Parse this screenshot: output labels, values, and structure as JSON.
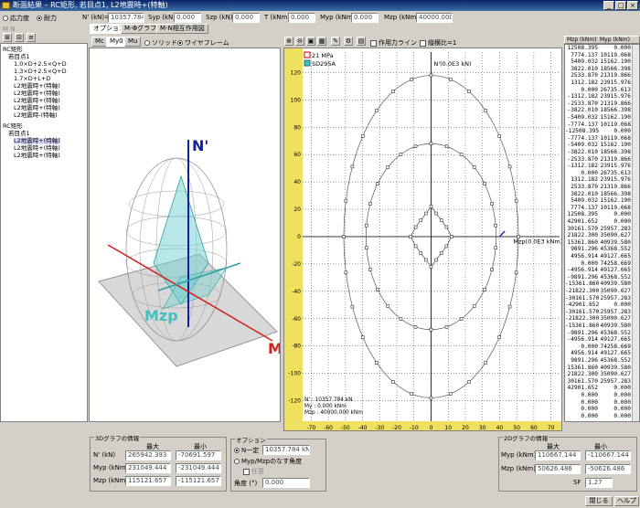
{
  "window": {
    "title": "断面結果 – RC矩形, 若目点1, L2地震時+(特軸)"
  },
  "toolbar_top": {
    "stress_label": "応力度",
    "yield_label": "耐力",
    "n_label": "N' (kN)=",
    "n_value": "10357.784",
    "syp_label": "Syp (kN)=",
    "syp_value": "0.000",
    "szp_label": "Szp (kN)=",
    "szp_value": "0.000",
    "t_label": "T (kNm)=",
    "t_value": "0.000",
    "myp_label": "Myp (kNm)=",
    "myp_value": "0.000",
    "mzp_label": "Mzp (kNm)=",
    "mzp_value": "40000.000",
    "sub_label": "M  N"
  },
  "tabs": [
    "オプション",
    "M-Φグラフ",
    "M-N相互作用図"
  ],
  "view_tabs": [
    "Mc",
    "My0",
    "Mu"
  ],
  "view_mode": {
    "solid": "ソリッド",
    "wire": "ワイヤフレーム"
  },
  "graph_toolbar": {
    "action_line": "作用力ライン",
    "ratio": "縦横比=1"
  },
  "tree": [
    "RC矩形",
    "若目点1",
    "1.0×D+2.5×Q+D",
    "1.3×D+2.5×Q+D",
    "1.7×D+L+D",
    "L2地震時+(特軸)",
    "L2地震時+(特軸)",
    "L2地震時+(特軸)",
    "L2地震時+(特軸)",
    "L2地震時-(特軸)",
    "RC矩形",
    "若目点1",
    "L2地震時+(特軸)",
    "L2地震時+(特軸)",
    "L2地震時+(特軸)"
  ],
  "axes3d": {
    "n": "N'",
    "mzp": "Mzp",
    "m": "M"
  },
  "plot": {
    "legend": [
      "21 MPa",
      "SD295A"
    ],
    "y_axis_label": "N'(0.0E3 kN)",
    "x_axis_label": "Mzp(0.0E3 kNm)",
    "x_ticks": [
      "-70",
      "-60",
      "-50",
      "-40",
      "-30",
      "-20",
      "-10",
      "0",
      "10",
      "20",
      "30",
      "40",
      "50",
      "60",
      "70"
    ],
    "y_ticks": [
      "120",
      "100",
      "80",
      "60",
      "40",
      "20",
      "0",
      "-20",
      "-40",
      "-60",
      "-80",
      "-100",
      "-120"
    ],
    "info_lines": [
      "N' : 10357.784 kN",
      "My : 0.000 kNm",
      "Mzp : 40000.000 kNm"
    ]
  },
  "list": {
    "headers": [
      "Mzp (kNm)",
      "Myp (kNm)"
    ],
    "rows": [
      [
        "12508.395",
        "0.000"
      ],
      [
        "7774.137",
        "10119.068"
      ],
      [
        "5409.032",
        "15162.190"
      ],
      [
        "3822.010",
        "18566.398"
      ],
      [
        "2533.870",
        "21319.866"
      ],
      [
        "1312.182",
        "23915.976"
      ],
      [
        "0.000",
        "26735.613"
      ],
      [
        "-1312.182",
        "23915.976"
      ],
      [
        "-2533.870",
        "21319.866"
      ],
      [
        "-3822.010",
        "18566.398"
      ],
      [
        "-5409.032",
        "15162.190"
      ],
      [
        "-7774.137",
        "10119.068"
      ],
      [
        "-12508.395",
        "0.000"
      ],
      [
        "-7774.137",
        "10119.068"
      ],
      [
        "-5409.032",
        "15162.190"
      ],
      [
        "-3822.010",
        "18566.398"
      ],
      [
        "-2533.870",
        "21319.866"
      ],
      [
        "-1312.182",
        "23915.976"
      ],
      [
        "0.000",
        "26735.613"
      ],
      [
        "1312.182",
        "23915.976"
      ],
      [
        "2533.870",
        "21319.866"
      ],
      [
        "3822.010",
        "18566.398"
      ],
      [
        "5409.032",
        "15162.190"
      ],
      [
        "7774.137",
        "10119.068"
      ],
      [
        "12508.395",
        "0.000"
      ],
      [
        "42901.652",
        "0.000"
      ],
      [
        "30161.570",
        "25957.283"
      ],
      [
        "21822.300",
        "35090.627"
      ],
      [
        "15361.860",
        "40939.580"
      ],
      [
        "9891.296",
        "45368.552"
      ],
      [
        "4956.914",
        "49127.665"
      ],
      [
        "0.000",
        "74258.669"
      ],
      [
        "-4956.914",
        "49127.665"
      ],
      [
        "-9891.296",
        "45368.552"
      ],
      [
        "-15361.860",
        "40939.580"
      ],
      [
        "-21822.300",
        "35090.627"
      ],
      [
        "-30161.570",
        "25957.283"
      ],
      [
        "-42901.652",
        "0.000"
      ],
      [
        "-30161.570",
        "25957.283"
      ],
      [
        "-21822.300",
        "35090.627"
      ],
      [
        "-15361.860",
        "40939.580"
      ],
      [
        "-9891.296",
        "45368.552"
      ],
      [
        "-4956.914",
        "49127.665"
      ],
      [
        "0.000",
        "74258.669"
      ],
      [
        "4956.914",
        "49127.665"
      ],
      [
        "9891.296",
        "45368.552"
      ],
      [
        "15361.860",
        "40939.580"
      ],
      [
        "21822.300",
        "35090.627"
      ],
      [
        "30161.570",
        "25957.283"
      ],
      [
        "42901.652",
        "0.000"
      ],
      [
        "0.000",
        "0.000"
      ],
      [
        "0.000",
        "0.000"
      ],
      [
        "0.000",
        "0.000"
      ],
      [
        "0.000",
        "0.000"
      ]
    ]
  },
  "panel3d": {
    "title": "3Dグラフの情報",
    "max": "最大",
    "min": "最小",
    "rows": [
      {
        "label": "N' (kN)",
        "max": "265942.393",
        "min": "-70691.597"
      },
      {
        "label": "Myp (kNm)",
        "max": "231049.444",
        "min": "-231049.444"
      },
      {
        "label": "Mzp (kNm)",
        "max": "115121.657",
        "min": "-115121.657"
      }
    ]
  },
  "options": {
    "title": "オプション",
    "n_const": "N一定",
    "n_const_value": "10357.784 kN",
    "angle_label": "Myp/Mzpのなす角度",
    "fixed": "任意",
    "angle": "角度 (°)",
    "angle_value": "0.000"
  },
  "panel2d": {
    "title": "2Dグラフの情報",
    "max": "最大",
    "min": "最小",
    "rows": [
      {
        "label": "Myp (kNm)",
        "max": "110667.144",
        "min": "-110667.144"
      },
      {
        "label": "Mzp (kNm)",
        "max": "50626.486",
        "min": "-50626.486"
      }
    ],
    "sf_label": "SF",
    "sf_value": "1.27"
  },
  "buttons": {
    "close": "閉じる",
    "help": "ヘルプ"
  },
  "colors": {
    "title_bar": "#0a246a",
    "cyan": "#40c0c0",
    "red": "#d02020",
    "blue": "#1020a0",
    "ruler": "#f0e060"
  }
}
